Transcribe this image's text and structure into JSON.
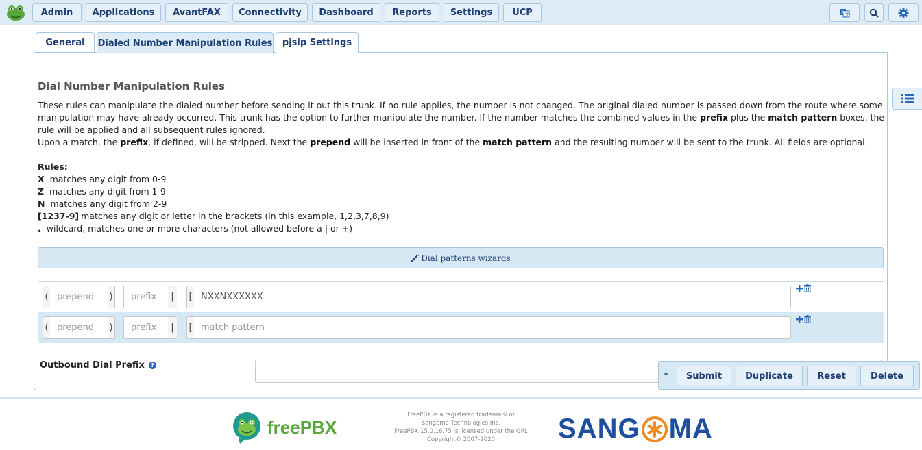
{
  "nav": {
    "items": [
      "Admin",
      "Applications",
      "AvantFAX",
      "Connectivity",
      "Dashboard",
      "Reports",
      "Settings",
      "UCP"
    ]
  },
  "icons": {
    "logo": "frog-logo-icon",
    "language": "translate-icon",
    "search": "search-icon",
    "settings": "gear-icon",
    "side": "list-icon"
  },
  "tabs": [
    "General",
    "Dialed Number Manipulation Rules",
    "pjsip Settings"
  ],
  "section": {
    "title": "Dial Number Manipulation Rules",
    "p1_a": "These rules can manipulate the dialed number before sending it out this trunk. If no rule applies, the number is not changed. The original dialed number is passed down from the route where some manipulation may have already occurred. This trunk has the option to further manipulate the number. If the number matches the combined values in the ",
    "p1_prefix": "prefix",
    "p1_b": " plus the ",
    "p1_mp": "match pattern",
    "p1_c": " boxes, the rule will be applied and all subsequent rules ignored.",
    "p2_a": "Upon a match, the ",
    "p2_prefix": "prefix",
    "p2_b": ", if defined, will be stripped. Next the ",
    "p2_prepend": "prepend",
    "p2_c": " will be inserted in front of the ",
    "p2_mp": "match pattern",
    "p2_d": " and the resulting number will be sent to the trunk. All fields are optional."
  },
  "rules": {
    "heading": "Rules:",
    "items": [
      {
        "key": "X",
        "text": "matches any digit from 0-9"
      },
      {
        "key": "Z",
        "text": "matches any digit from 1-9"
      },
      {
        "key": "N",
        "text": "matches any digit from 2-9"
      },
      {
        "key": "[1237-9]",
        "text": "matches any digit or letter in the brackets (in this example, 1,2,3,7,8,9)"
      },
      {
        "key": ".",
        "text": "wildcard, matches one or more characters (not allowed before a | or +)"
      }
    ]
  },
  "wizard": {
    "label": "Dial patterns wizards"
  },
  "patterns": {
    "rows": [
      {
        "prepend_ph": "prepend",
        "prefix_ph": "prefix",
        "match_value": "NXXNXXXXXX",
        "match_ph": "match pattern"
      },
      {
        "prepend_ph": "prepend",
        "prefix_ph": "prefix",
        "match_value": "",
        "match_ph": "match pattern"
      }
    ],
    "brackets": {
      "open_paren": "(",
      "close_paren": ")",
      "pipe": "|",
      "open_bracket": "["
    }
  },
  "outbound": {
    "label": "Outbound Dial Prefix",
    "help": "?"
  },
  "actions": {
    "toggle": "»",
    "submit": "Submit",
    "duplicate": "Duplicate",
    "reset": "Reset",
    "delete": "Delete"
  },
  "footer": {
    "brand": "freePBX",
    "line1": "FreePBX is a registered trademark of",
    "line2": "Sangoma Technologies Inc.",
    "line3": "FreePBX 15.0.16.75 is licensed under the GPL",
    "line4": "Copyright© 2007-2020",
    "sangoma_a": "SANG",
    "sangoma_b": "MA"
  },
  "colors": {
    "nav_text": "#1f3f73",
    "accent_green": "#58a63c",
    "sangoma_blue": "#1d4f9c",
    "sangoma_orange": "#f08a24"
  }
}
